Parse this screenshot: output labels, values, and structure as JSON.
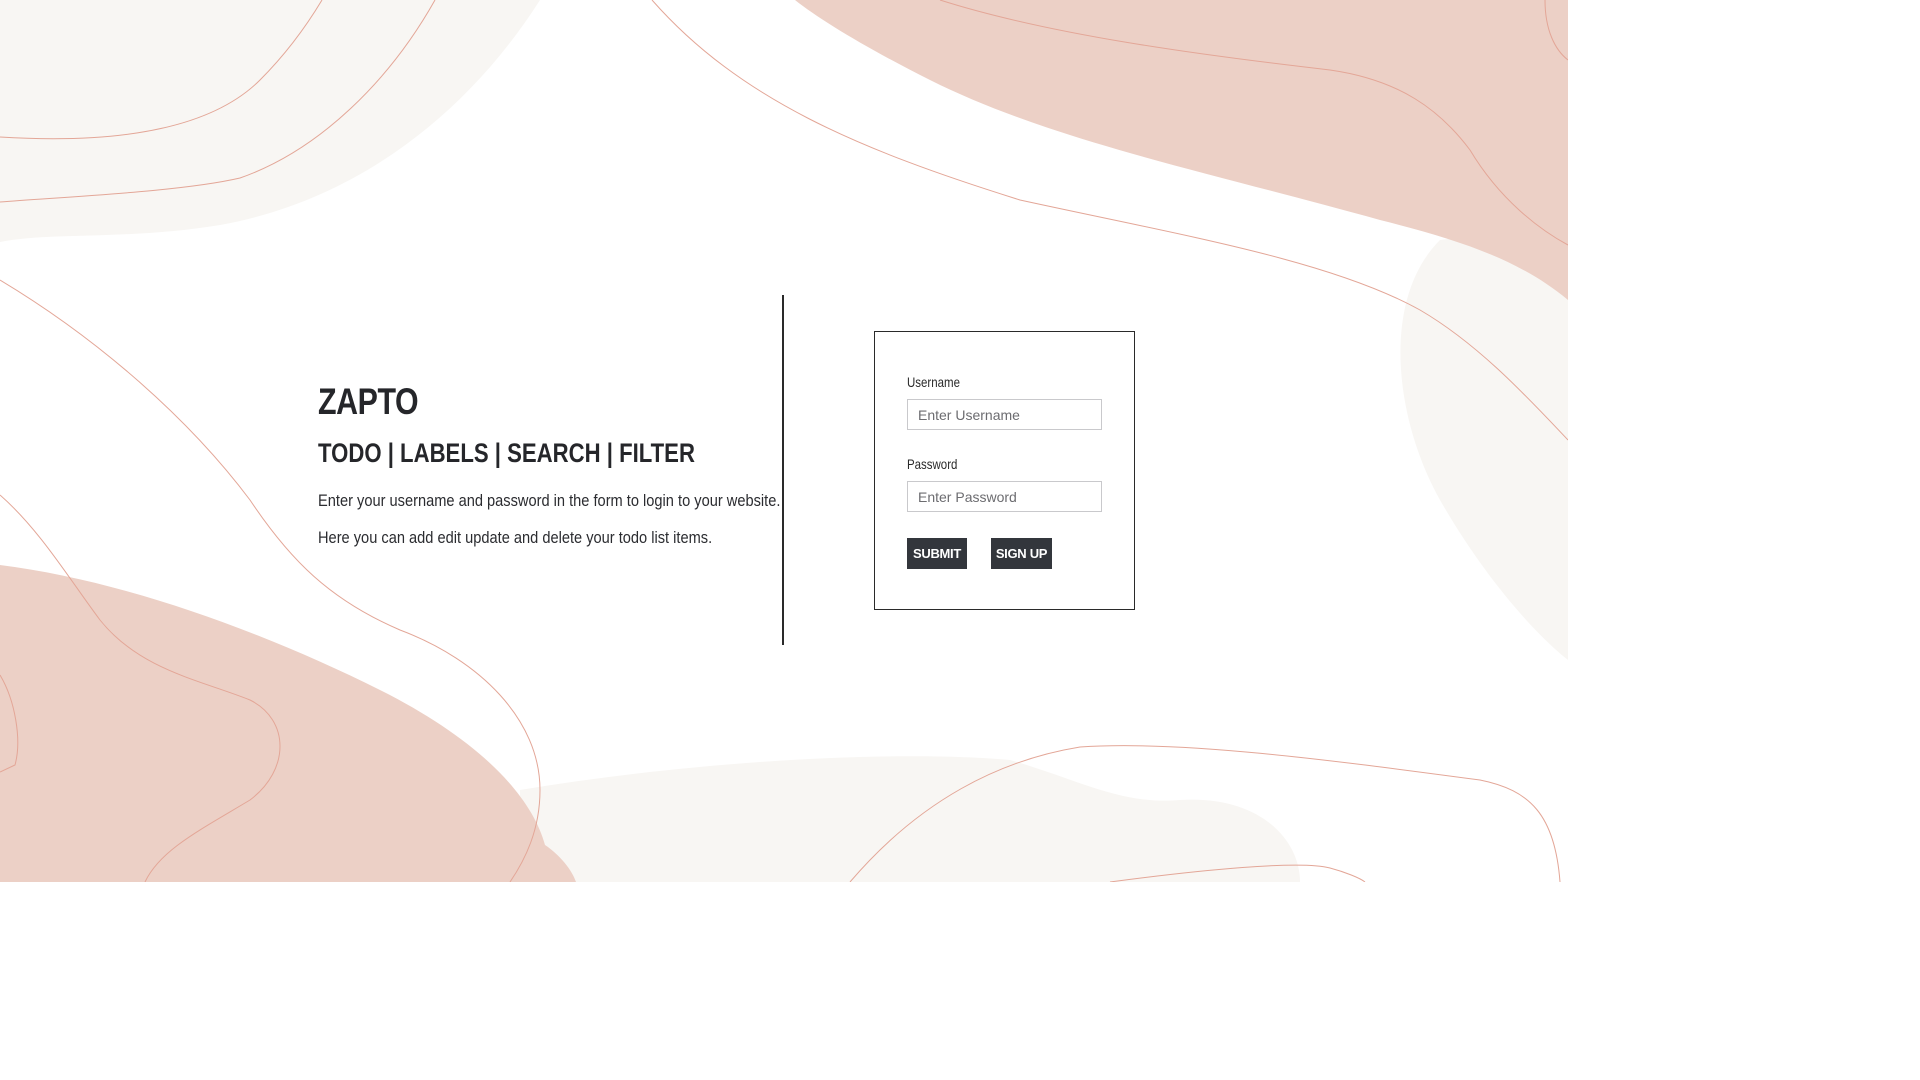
{
  "branding": {
    "app_name": "ZAPTO",
    "tagline": "TODO | LABELS | SEARCH | FILTER"
  },
  "intro": {
    "line1": "Enter your username and password in the form to login to your website.",
    "line2": "Here you can add edit update and delete your todo list items."
  },
  "login_form": {
    "username_label": "Username",
    "username_placeholder": "Enter Username",
    "username_value": "",
    "password_label": "Password",
    "password_placeholder": "Enter Password",
    "password_value": "",
    "submit_label": "SUBMIT",
    "signup_label": "SIGN UP"
  },
  "theme": {
    "blob_rose": "#ecd0c6",
    "blob_cream": "#f8f6f3",
    "line_color": "#e3a697",
    "button_bg": "#33363c"
  }
}
